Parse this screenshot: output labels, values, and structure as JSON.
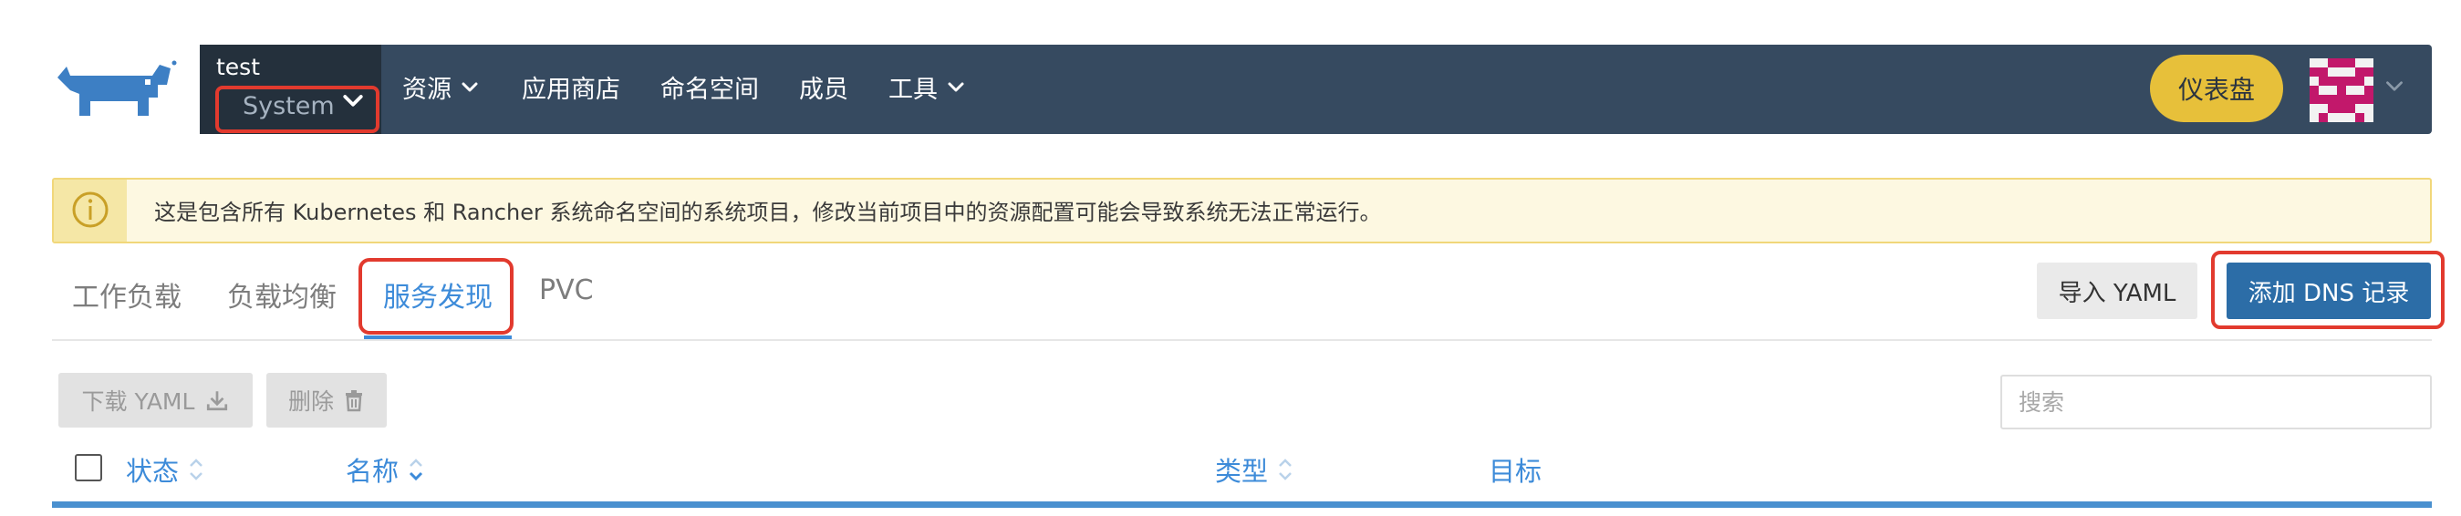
{
  "header": {
    "project_name": "test",
    "project_selected": "System",
    "nav": [
      "资源",
      "应用商店",
      "命名空间",
      "成员",
      "工具"
    ],
    "dashboard_label": "仪表盘"
  },
  "banner": {
    "text": "这是包含所有 Kubernetes 和 Rancher 系统命名空间的系统项目，修改当前项目中的资源配置可能会导致系统无法正常运行。"
  },
  "tabs": [
    "工作负载",
    "负载均衡",
    "服务发现",
    "PVC"
  ],
  "active_tab": "服务发现",
  "actions": {
    "import_yaml": "导入 YAML",
    "add_dns": "添加 DNS 记录"
  },
  "toolbar": {
    "download_yaml": "下载 YAML",
    "delete": "删除",
    "search_placeholder": "搜索"
  },
  "table": {
    "columns": [
      "状态",
      "名称",
      "类型",
      "目标"
    ]
  },
  "colors": {
    "header_bg": "#364a60",
    "accent_blue": "#3d8bd9",
    "highlight_red": "#e23a2e",
    "dashboard_yellow": "#e7c03a",
    "primary_button": "#2c6da7"
  }
}
